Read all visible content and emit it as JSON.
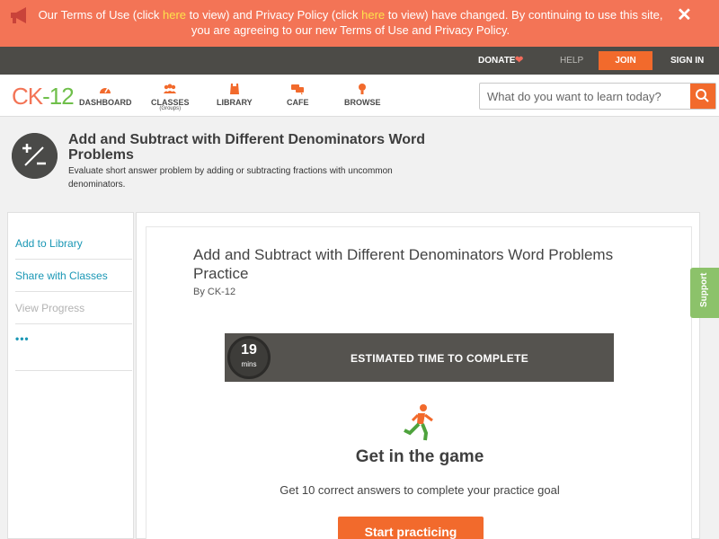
{
  "banner": {
    "text_1": "Our Terms of Use (click ",
    "link_1": "here",
    "text_2": " to view) and Privacy Policy (click ",
    "link_2": "here",
    "text_3": " to view) have changed. By continuing to use this site, you are agreeing to our new Terms of Use and Privacy Policy.",
    "close_label": "✕",
    "icon": "megaphone-icon"
  },
  "topbar": {
    "donate": "DONATE",
    "heart_icon": "heart-icon",
    "help": "HELP",
    "join": "JOIN",
    "signin": "SIGN IN"
  },
  "nav": {
    "logo_c": "CK",
    "logo_dash": "-",
    "logo_num": "12",
    "items": [
      {
        "label": "DASHBOARD",
        "icon": "dashboard-icon"
      },
      {
        "label": "CLASSES",
        "sub": "(Groups)",
        "icon": "classes-icon"
      },
      {
        "label": "LIBRARY",
        "icon": "library-icon"
      },
      {
        "label": "CAFE",
        "icon": "cafe-icon"
      },
      {
        "label": "BROWSE",
        "icon": "browse-icon"
      }
    ],
    "search_placeholder": "What do you want to learn today?"
  },
  "page": {
    "title": "Add and Subtract with Different Denominators Word Problems",
    "description": "Evaluate short answer problem by adding or subtracting fractions with uncommon denominators."
  },
  "sidebar": {
    "items": [
      "Add to Library",
      "Share with Classes",
      "View Progress",
      "•••"
    ]
  },
  "card": {
    "title": "Add and Subtract with Different Denominators Word Problems Practice",
    "by": "By CK-12",
    "time_num": "19",
    "time_unit": "mins",
    "time_label": "ESTIMATED TIME TO COMPLETE",
    "game_heading": "Get in the game",
    "game_desc": "Get 10 correct answers to complete your practice goal",
    "start_button": "Start practicing"
  },
  "support": "Support",
  "colors": {
    "banner": "#f37456",
    "accent": "#f26a2c",
    "topbar": "#4c4b47",
    "link": "#1a97b5",
    "support": "#8cc26a"
  }
}
